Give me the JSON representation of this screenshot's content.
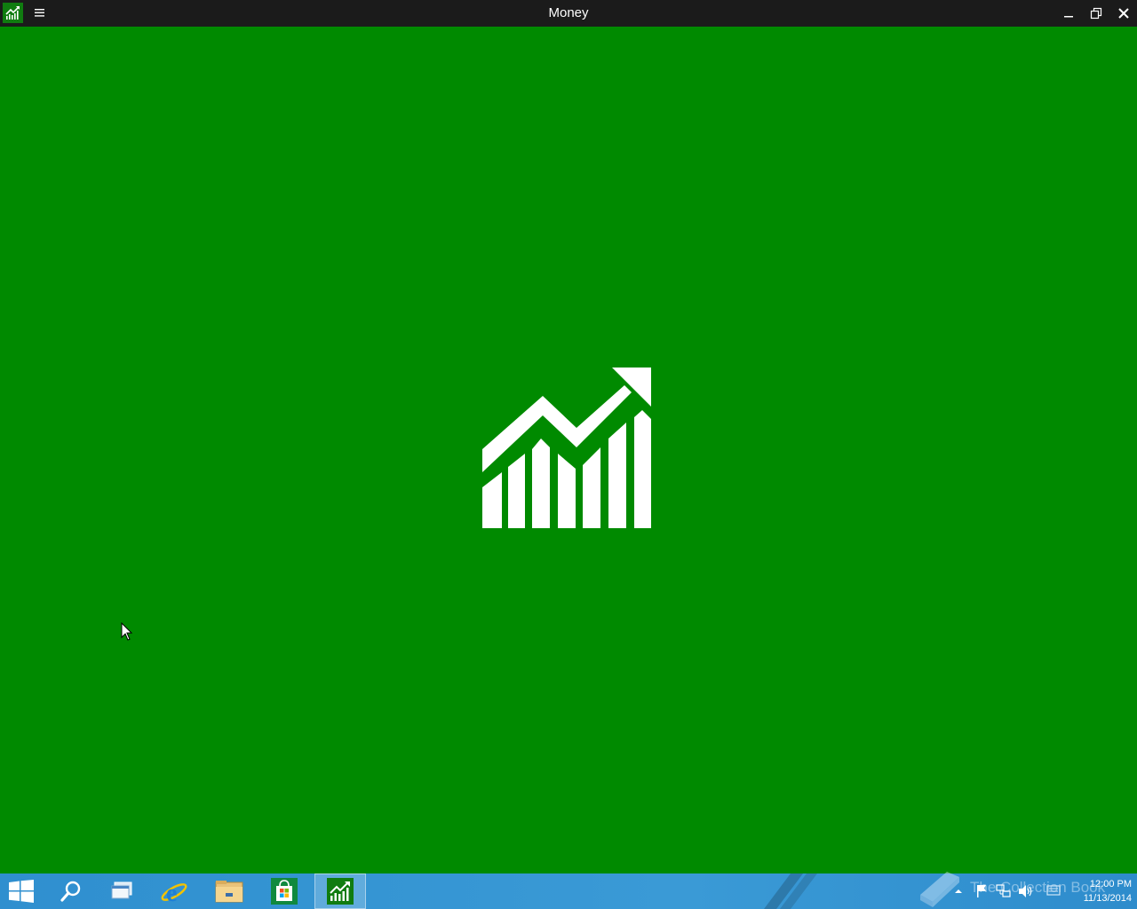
{
  "window": {
    "title": "Money",
    "app_icon": "money-chart-icon",
    "menu_icon": "hamburger-icon",
    "controls": {
      "minimize_icon": "minimize-icon",
      "maximize_icon": "restore-icon",
      "close_icon": "close-icon"
    }
  },
  "splash": {
    "logo_icon": "rising-bar-chart-icon",
    "background_color": "#008a00"
  },
  "taskbar": {
    "buttons": [
      {
        "name": "start",
        "icon": "windows-logo-icon"
      },
      {
        "name": "search",
        "icon": "search-icon"
      },
      {
        "name": "task-view",
        "icon": "task-view-icon"
      },
      {
        "name": "internet-explorer",
        "icon": "ie-icon"
      },
      {
        "name": "file-explorer",
        "icon": "folder-icon"
      },
      {
        "name": "store",
        "icon": "store-bag-icon"
      },
      {
        "name": "money",
        "icon": "money-chart-icon",
        "active": true
      }
    ],
    "watermark": "The Collection Book",
    "tray_icons": [
      "chevron-up-icon",
      "flag-icon",
      "network-icon",
      "volume-icon",
      "message-icon"
    ],
    "clock": {
      "time": "12:00 PM",
      "date": "11/13/2014"
    }
  },
  "colors": {
    "accent": "#107c10",
    "titlebar": "#1b1b1b",
    "taskbar": "#3a9ad6"
  }
}
